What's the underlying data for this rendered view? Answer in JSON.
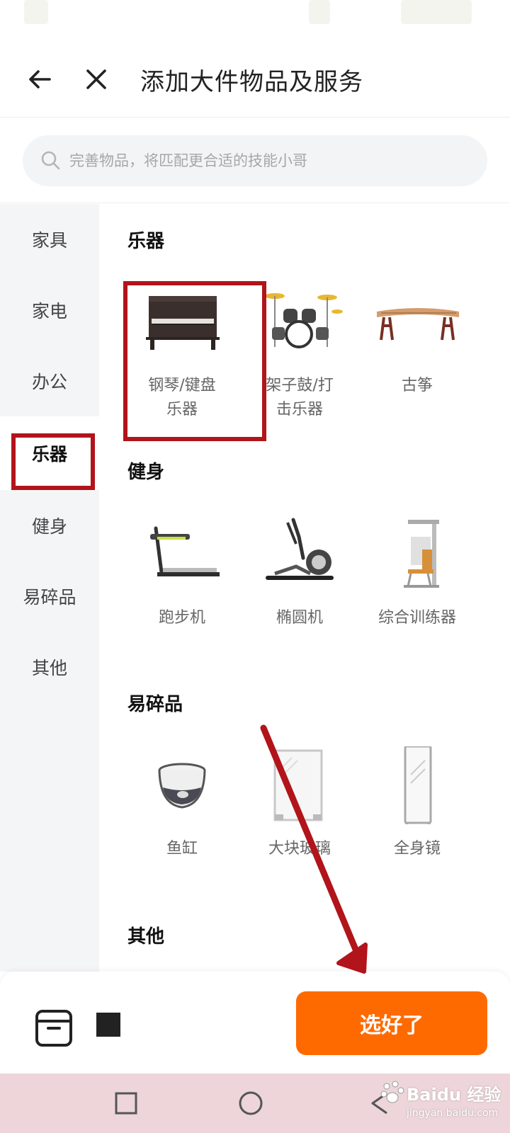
{
  "header": {
    "title": "添加大件物品及服务"
  },
  "search": {
    "placeholder": "完善物品，将匹配更合适的技能小哥"
  },
  "sidebar": {
    "items": [
      {
        "label": "家具"
      },
      {
        "label": "家电"
      },
      {
        "label": "办公"
      },
      {
        "label": "乐器",
        "active": true
      },
      {
        "label": "健身"
      },
      {
        "label": "易碎品"
      },
      {
        "label": "其他"
      }
    ]
  },
  "sections": [
    {
      "title": "乐器",
      "items": [
        {
          "line1": "钢琴/键盘",
          "line2": "乐器",
          "icon": "piano-icon"
        },
        {
          "line1": "架子鼓/打",
          "line2": "击乐器",
          "icon": "drum-kit-icon"
        },
        {
          "line1": "古筝",
          "line2": "",
          "icon": "guzheng-icon"
        }
      ]
    },
    {
      "title": "健身",
      "items": [
        {
          "line1": "跑步机",
          "line2": "",
          "icon": "treadmill-icon"
        },
        {
          "line1": "椭圆机",
          "line2": "",
          "icon": "elliptical-icon"
        },
        {
          "line1": "综合训练器",
          "line2": "",
          "icon": "multi-gym-icon"
        }
      ]
    },
    {
      "title": "易碎品",
      "items": [
        {
          "line1": "鱼缸",
          "line2": "",
          "icon": "fish-tank-icon"
        },
        {
          "line1": "大块玻璃",
          "line2": "",
          "icon": "glass-panel-icon"
        },
        {
          "line1": "全身镜",
          "line2": "",
          "icon": "mirror-icon"
        }
      ]
    },
    {
      "title": "其他",
      "items": []
    }
  ],
  "footer": {
    "done_label": "选好了"
  },
  "watermark": {
    "brand": "Baidu 经验",
    "sub": "jingyan.baidu.com"
  },
  "colors": {
    "accent": "#fe6a00",
    "annotation_red": "#b1141a",
    "sidebar_bg": "#f4f5f7"
  }
}
